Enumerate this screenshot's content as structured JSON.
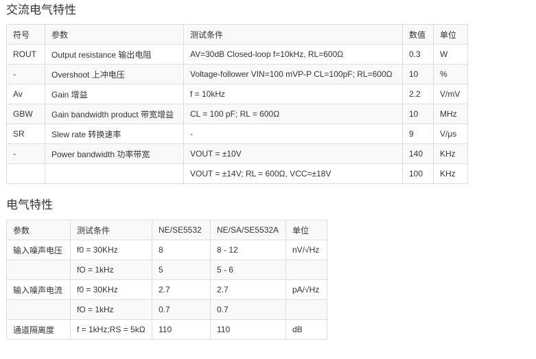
{
  "section1": {
    "title": "交流电气特性",
    "headers": [
      "符号",
      "参数",
      "测试条件",
      "数值",
      "单位"
    ],
    "rows": [
      [
        "ROUT",
        "Output resistance 输出电阻",
        "AV=30dB Closed-loop f=10kHz, RL=600Ω",
        "0.3",
        "W"
      ],
      [
        "-",
        "Overshoot 上冲电压",
        "Voltage-follower VIN=100 mVP-P CL=100pF; RL=600Ω",
        "10",
        "%"
      ],
      [
        "Av",
        "Gain 增益",
        "f = 10kHz",
        "2.2",
        "V/mV"
      ],
      [
        "GBW",
        "Gain bandwidth product 带宽增益",
        "CL = 100 pF; RL = 600Ω",
        "10",
        "MHz"
      ],
      [
        "SR",
        "Slew rate 转换速率",
        "-",
        "9",
        "V/μs"
      ],
      [
        "-",
        "Power bandwidth 功率带宽",
        "VOUT = ±10V",
        "140",
        "KHz"
      ],
      [
        "",
        "",
        "VOUT = ±14V; RL = 600Ω, VCC=±18V",
        "100",
        "KHz"
      ]
    ]
  },
  "section2": {
    "title": "电气特性",
    "headers": [
      "参数",
      "测试条件",
      "NE/SE5532",
      "NE/SA/SE5532A",
      "单位"
    ],
    "rows": [
      [
        "输入噪声电压",
        "f0 = 30KHz",
        "8",
        "8 - 12",
        "nV/√Hz"
      ],
      [
        "",
        "fO = 1kHz",
        "5",
        "5 - 6",
        ""
      ],
      [
        "输入噪声电流",
        "f0 = 30KHz",
        "2.7",
        "2.7",
        "pA/√Hz"
      ],
      [
        "",
        "fO = 1kHz",
        "0.7",
        "0.7",
        ""
      ],
      [
        "通道隔离度",
        "f = 1kHz;RS = 5kΩ",
        "110",
        "110",
        "dB"
      ]
    ]
  }
}
